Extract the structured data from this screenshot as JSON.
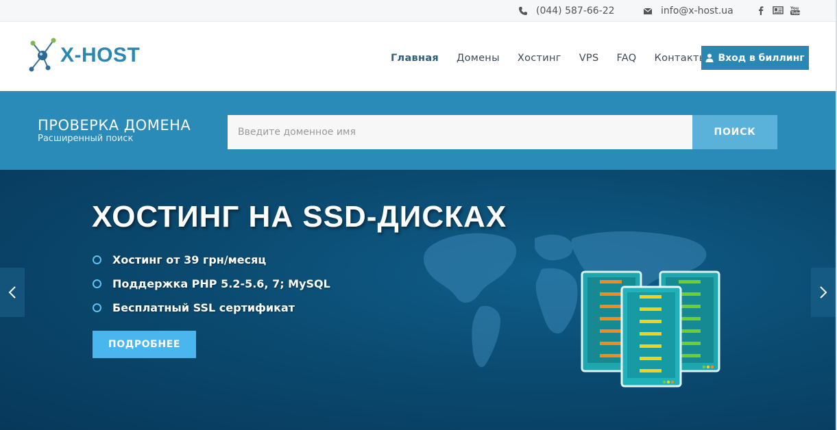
{
  "topbar": {
    "phone": "(044) 587-66-22",
    "email": "info@x-host.ua",
    "icons": [
      "phone-icon",
      "envelope-icon",
      "facebook-icon",
      "vcard-icon",
      "youtube-icon"
    ]
  },
  "header": {
    "logo_text": "X-HOST",
    "nav": [
      {
        "label": "Главная",
        "active": true
      },
      {
        "label": "Домены"
      },
      {
        "label": "Хостинг"
      },
      {
        "label": "VPS"
      },
      {
        "label": "FAQ"
      },
      {
        "label": "Контакты"
      }
    ],
    "billing_label": "Вход в биллинг"
  },
  "domain_search": {
    "title": "ПРОВЕРКА ДОМЕНА",
    "subtitle": "Расширенный поиск",
    "placeholder": "Введите доменное имя",
    "button": "ПОИСК"
  },
  "hero": {
    "title": "ХОСТИНГ НА SSD-ДИСКАХ",
    "features": [
      "Хостинг от 39 грн/месяц",
      "Поддержка PHP 5.2-5.6, 7; MySQL",
      "Бесплатный SSL сертификат"
    ],
    "button": "ПОДРОБНЕЕ"
  },
  "colors": {
    "brand": "#2a87b4",
    "band": "#2a8ab8",
    "accent_button": "#49b7ee",
    "hero_bg": "#0b4a70"
  }
}
